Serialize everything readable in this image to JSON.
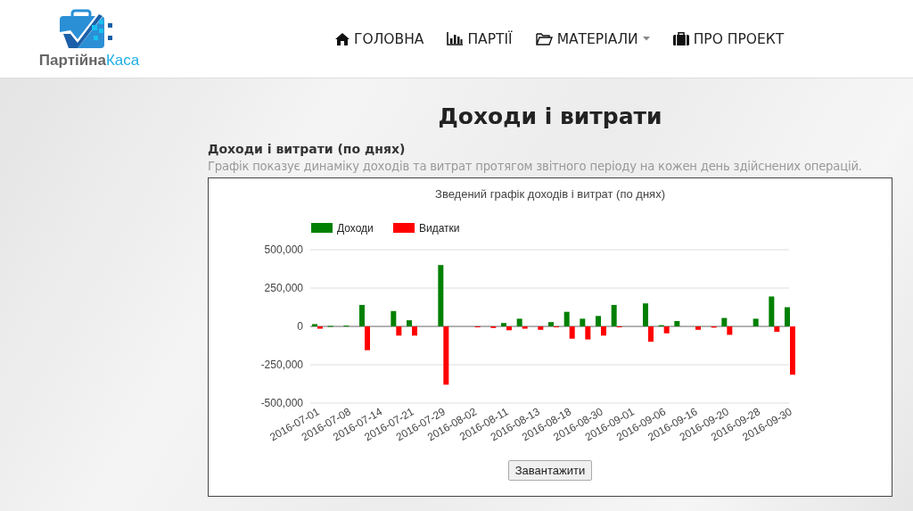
{
  "logo": {
    "name_first": "Партійна",
    "name_second": "Каса"
  },
  "nav": [
    {
      "label": "ГОЛОВНА",
      "kind": "home",
      "dropdown": false
    },
    {
      "label": "ПАРТІЇ",
      "kind": "chart",
      "dropdown": false
    },
    {
      "label": "МАТЕРІАЛИ",
      "kind": "folder",
      "dropdown": true
    },
    {
      "label": "ПРО ПРОЕКТ",
      "kind": "briefcase",
      "dropdown": false
    }
  ],
  "page_title": "Доходи і витрати",
  "section": {
    "title": "Доходи і витрати (по днях)",
    "description": "Графік показує динаміку доходів та витрат протягом звітного періоду на кожен день здійснених операцій."
  },
  "chart_data": {
    "type": "bar",
    "title": "Зведений графік доходів і витрат (по днях)",
    "categories": [
      "2016-07-01",
      null,
      "2016-07-08",
      null,
      "2016-07-14",
      null,
      "2016-07-21",
      null,
      "2016-07-29",
      null,
      "2016-08-02",
      null,
      "2016-08-11",
      null,
      "2016-08-13",
      null,
      "2016-08-18",
      null,
      "2016-08-30",
      null,
      "2016-09-01",
      null,
      "2016-09-06",
      null,
      "2016-09-16",
      null,
      "2016-09-20",
      null,
      "2016-09-28",
      null,
      "2016-09-30"
    ],
    "series": [
      {
        "name": "Доходи",
        "color": "#008000",
        "values": [
          15000,
          3000,
          5000,
          140000,
          0,
          100000,
          40000,
          0,
          400000,
          0,
          0,
          0,
          22000,
          50000,
          0,
          28000,
          95000,
          50000,
          68000,
          140000,
          0,
          150000,
          8000,
          35000,
          0,
          0,
          55000,
          0,
          50000,
          195000,
          125000
        ]
      },
      {
        "name": "Видатки",
        "color": "#ff0000",
        "values": [
          -15000,
          0,
          0,
          -155000,
          0,
          -60000,
          -60000,
          0,
          -380000,
          0,
          -3000,
          -10000,
          -25000,
          -15000,
          -22000,
          -5000,
          -80000,
          -85000,
          -60000,
          -5000,
          0,
          -100000,
          -45000,
          0,
          -22000,
          -8000,
          -55000,
          0,
          0,
          -35000,
          -315000
        ]
      }
    ],
    "ylim": [
      -500000,
      500000
    ],
    "legend": "top",
    "yticks": [
      {
        "value": 500000,
        "label": "500,000"
      },
      {
        "value": 250000,
        "label": "250,000"
      },
      {
        "value": 0,
        "label": "0"
      },
      {
        "value": -250000,
        "label": "-250,000"
      },
      {
        "value": -500000,
        "label": "-500,000"
      }
    ]
  },
  "download_button": "Завантажити"
}
